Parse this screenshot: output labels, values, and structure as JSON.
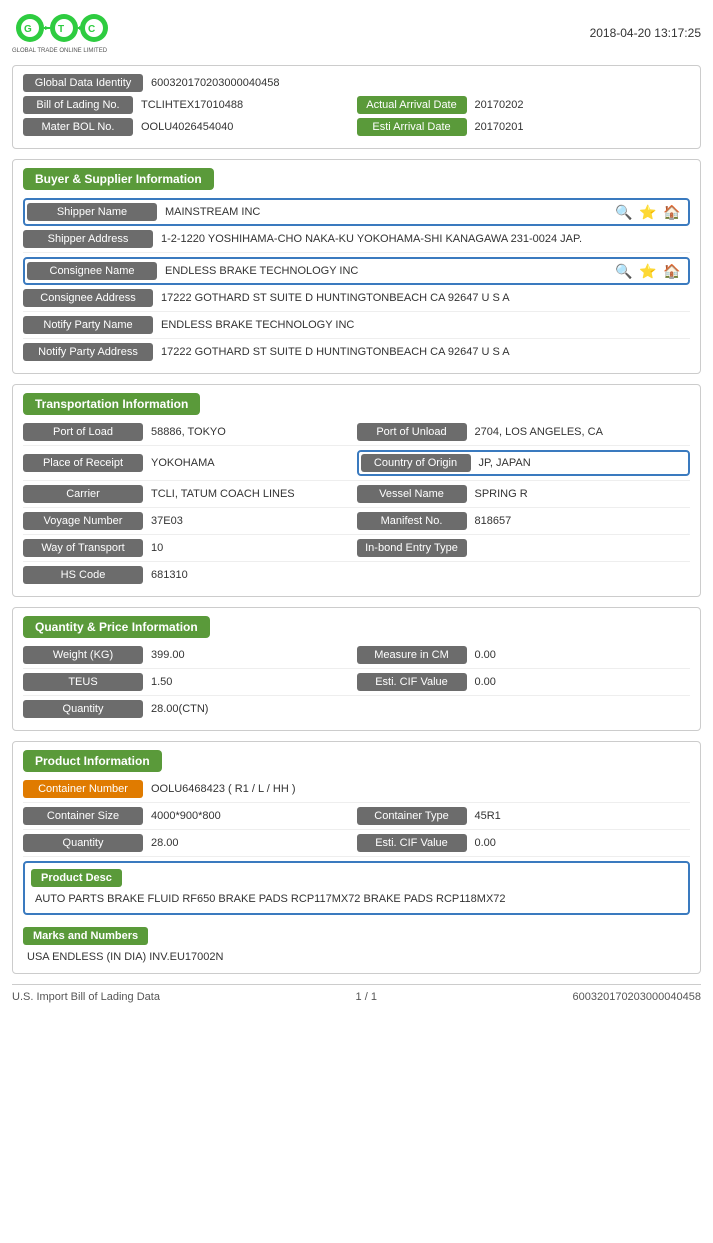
{
  "header": {
    "timestamp": "2018-04-20 13:17:25",
    "logo_text": "GLOBAL TRADE ONLINE LIMITED"
  },
  "top_info": {
    "global_data_identity_label": "Global Data Identity",
    "global_data_identity_value": "600320170203000040458",
    "bill_of_lading_label": "Bill of Lading No.",
    "bill_of_lading_value": "TCLIHTEX17010488",
    "actual_arrival_label": "Actual Arrival Date",
    "actual_arrival_value": "20170202",
    "mater_bol_label": "Mater BOL No.",
    "mater_bol_value": "OOLU4026454040",
    "esti_arrival_label": "Esti Arrival Date",
    "esti_arrival_value": "20170201"
  },
  "buyer_supplier": {
    "section_title": "Buyer & Supplier Information",
    "shipper_name_label": "Shipper Name",
    "shipper_name_value": "MAINSTREAM INC",
    "shipper_address_label": "Shipper Address",
    "shipper_address_value": "1-2-1220 YOSHIHAMA-CHO NAKA-KU YOKOHAMA-SHI KANAGAWA 231-0024 JAP.",
    "consignee_name_label": "Consignee Name",
    "consignee_name_value": "ENDLESS BRAKE TECHNOLOGY INC",
    "consignee_address_label": "Consignee Address",
    "consignee_address_value": "17222 GOTHARD ST SUITE D HUNTINGTONBEACH CA 92647 U S A",
    "notify_party_name_label": "Notify Party Name",
    "notify_party_name_value": "ENDLESS BRAKE TECHNOLOGY INC",
    "notify_party_address_label": "Notify Party Address",
    "notify_party_address_value": "17222 GOTHARD ST SUITE D HUNTINGTONBEACH CA 92647 U S A"
  },
  "transportation": {
    "section_title": "Transportation Information",
    "port_of_load_label": "Port of Load",
    "port_of_load_value": "58886, TOKYO",
    "port_of_unload_label": "Port of Unload",
    "port_of_unload_value": "2704, LOS ANGELES, CA",
    "place_of_receipt_label": "Place of Receipt",
    "place_of_receipt_value": "YOKOHAMA",
    "country_of_origin_label": "Country of Origin",
    "country_of_origin_value": "JP, JAPAN",
    "carrier_label": "Carrier",
    "carrier_value": "TCLI, TATUM COACH LINES",
    "vessel_name_label": "Vessel Name",
    "vessel_name_value": "SPRING R",
    "voyage_number_label": "Voyage Number",
    "voyage_number_value": "37E03",
    "manifest_label": "Manifest No.",
    "manifest_value": "818657",
    "way_of_transport_label": "Way of Transport",
    "way_of_transport_value": "10",
    "inbond_label": "In-bond Entry Type",
    "inbond_value": "",
    "hs_code_label": "HS Code",
    "hs_code_value": "681310"
  },
  "quantity_price": {
    "section_title": "Quantity & Price Information",
    "weight_label": "Weight (KG)",
    "weight_value": "399.00",
    "measure_label": "Measure in CM",
    "measure_value": "0.00",
    "teus_label": "TEUS",
    "teus_value": "1.50",
    "esti_cif_label": "Esti. CIF Value",
    "esti_cif_value": "0.00",
    "quantity_label": "Quantity",
    "quantity_value": "28.00(CTN)"
  },
  "product_info": {
    "section_title": "Product Information",
    "container_number_label": "Container Number",
    "container_number_value": "OOLU6468423 ( R1 / L / HH )",
    "container_size_label": "Container Size",
    "container_size_value": "4000*900*800",
    "container_type_label": "Container Type",
    "container_type_value": "45R1",
    "quantity_label": "Quantity",
    "quantity_value": "28.00",
    "esti_cif_label": "Esti. CIF Value",
    "esti_cif_value": "0.00",
    "product_desc_label": "Product Desc",
    "product_desc_value": "AUTO PARTS BRAKE FLUID RF650 BRAKE PADS RCP117MX72 BRAKE PADS RCP118MX72",
    "marks_numbers_label": "Marks and Numbers",
    "marks_numbers_value": "USA ENDLESS (IN DIA) INV.EU17002N"
  },
  "footer": {
    "left_text": "U.S. Import Bill of Lading Data",
    "page_info": "1 / 1",
    "right_text": "600320170203000040458"
  }
}
